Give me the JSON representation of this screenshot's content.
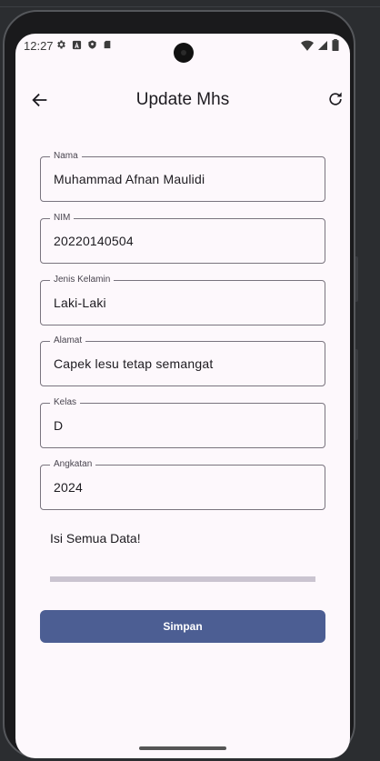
{
  "status_bar": {
    "time": "12:27",
    "left_icons": [
      "gear-icon",
      "a-icon",
      "shield-icon",
      "sd-card-icon"
    ],
    "right_icons": [
      "wifi-icon",
      "signal-icon",
      "battery-icon"
    ]
  },
  "app_bar": {
    "title": "Update Mhs",
    "back_icon": "arrow-left-icon",
    "refresh_icon": "refresh-icon"
  },
  "form": {
    "fields": [
      {
        "label": "Nama",
        "value": "Muhammad Afnan Maulidi"
      },
      {
        "label": "NIM",
        "value": "20220140504"
      },
      {
        "label": "Jenis Kelamin",
        "value": "Laki-Laki"
      },
      {
        "label": "Alamat",
        "value": "Capek lesu tetap semangat"
      },
      {
        "label": "Kelas",
        "value": "D"
      },
      {
        "label": "Angkatan",
        "value": "2024"
      }
    ],
    "hint": "Isi Semua Data!",
    "progress": 0,
    "submit_label": "Simpan"
  },
  "colors": {
    "primary": "#4c5e93",
    "background": "#fdf8fc",
    "outline": "#79747e"
  }
}
